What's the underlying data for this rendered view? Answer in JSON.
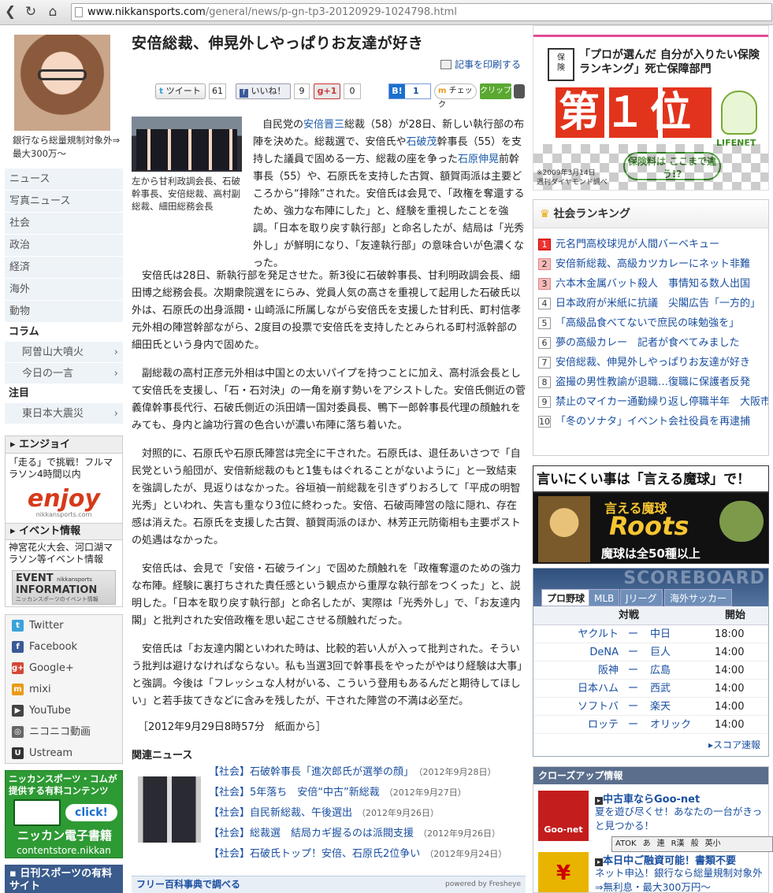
{
  "browser": {
    "url_host": "www.nikkansports.com",
    "url_path": "/general/news/p-gn-tp3-20120929-1024798.html"
  },
  "left": {
    "promo_text": "銀行なら総量規制対象外⇒最大300万〜",
    "nav": [
      "ニュース",
      "写真ニュース",
      "社会",
      "政治",
      "経済",
      "海外",
      "動物"
    ],
    "column_heading": "コラム",
    "column_items": [
      "阿曽山大噴火",
      "今日の一言"
    ],
    "attention_heading": "注目",
    "attention_items": [
      "東日本大震災"
    ],
    "enjoy_heading": "エンジョイ",
    "enjoy_text": "「走る」で挑戦！フルマラソン4時間以内",
    "enjoy_logo": "enjoy",
    "enjoy_site": "nikkansports.com",
    "event_heading": "イベント情報",
    "event_text": "神宮花火大会、河口湖マラソン等イベント情報",
    "event_logo_top": "EVENT",
    "event_logo_small": "nikkansports",
    "event_logo_bottom": "INFORMATION",
    "event_logo_caption": "ニッカンスポーツのイベント情報",
    "social": [
      {
        "label": "Twitter",
        "icon": "t",
        "color": "#3aa3d9"
      },
      {
        "label": "Facebook",
        "icon": "f",
        "color": "#3b5998"
      },
      {
        "label": "Google+",
        "icon": "g+",
        "color": "#d34836"
      },
      {
        "label": "mixi",
        "icon": "m",
        "color": "#e89b1a"
      },
      {
        "label": "YouTube",
        "icon": "▶",
        "color": "#444"
      },
      {
        "label": "ニコニコ動画",
        "icon": "◎",
        "color": "#666"
      },
      {
        "label": "Ustream",
        "icon": "U",
        "color": "#333"
      }
    ],
    "contents_heading": "ニッカンスポーツ・コムが提供する有料コンテンツ",
    "contents_click": "click!",
    "contents_title": "ニッカン電子書籍",
    "contents_site": "contentstore.nikkan",
    "paid_heading": "日刊スポーツの有料サイト"
  },
  "article": {
    "title": "安倍総裁、伸晃外しやっぱりお友達が好き",
    "print_label": "記事を印刷する",
    "tweet_label": "ツイート",
    "tweet_count": "61",
    "like_label": "いいね！",
    "like_count": "9",
    "gplus_label": "+1",
    "gplus_count": "0",
    "hatena_count": "1",
    "check_label": "チェック",
    "clip_label": "クリップ",
    "photo_caption": "左から甘利政調会長、石破幹事長、安倍総裁、高村副総裁、細田総務会長",
    "p1_pre": "自民党の",
    "p1_link1": "安倍晋三",
    "p1_mid1": "総裁（58）が28日、新しい執行部の布陣を決めた。総裁選で、安倍氏や",
    "p1_link2": "石破茂",
    "p1_mid2": "幹事長（55）を支持した議員で固める一方、総裁の座を争った",
    "p1_link3": "石原伸晃",
    "p1_rest": "前幹事長（55）や、石原氏を支持した古賀、額賀両派は主要どころから“排除”された。安倍氏は会見で、「政権を奪還するため、強力な布陣にした」と、経験を重視したことを強調。「日本を取り戻す執行部」と命名したが、結局は「光秀外し」が鮮明になり、「友達執行部」の意味合いが色濃くなった。",
    "p2": "安倍氏は28日、新執行部を発足させた。新3役に石破幹事長、甘利明政調会長、細田博之総務会長。次期衆院選をにらみ、党員人気の高さを重視して起用した石破氏以外は、石原氏の出身派閥・山崎派に所属しながら安倍氏を支援した甘利氏、町村信孝元外相の陣営幹部ながら、2度目の投票で安倍氏を支持したとみられる町村派幹部の細田氏という身内で固めた。",
    "p3": "副総裁の高村正彦元外相は中国との太いパイプを持つことに加え、高村派会長として安倍氏を支援し、「石・石対決」の一角を崩す勢いをアシストした。安倍氏側近の菅義偉幹事長代行、石破氏側近の浜田靖一国対委員長、鴨下一郎幹事長代理の顔触れをみても、身内と論功行賞の色合いが濃い布陣に落ち着いた。",
    "p4": "対照的に、石原氏や石原氏陣営は完全に干された。石原氏は、退任あいさつで「自民党という船団が、安倍新総裁のもと1隻もはぐれることがないように」と一致結束を強調したが、見返りはなかった。谷垣禎一前総裁を引きずりおろして「平成の明智光秀」といわれ、失言も重なり3位に終わった。安倍、石破両陣営の陰に隠れ、存在感は消えた。石原氏を支援した古賀、額賀両派のほか、林芳正元防衛相も主要ポストの処遇はなかった。",
    "p5": "安倍氏は、会見で「安倍・石破ライン」で固めた顔触れを「政権奪還のための強力な布陣。経験に裏打ちされた責任感という観点から重厚な執行部をつくった」と、説明した。「日本を取り戻す執行部」と命名したが、実際は「光秀外し」で、「お友達内閣」と批判された安倍政権を思い起こさせる顔触れだった。",
    "p6": "安倍氏は「お友達内閣といわれた時は、比較的若い人が入って批判された。そういう批判は避けなければならない。私も当選3回で幹事長をやったがやはり経験は大事」と強調。今後は「フレッシュな人材がいる、こういう登用もあるんだと期待してほしい」と若手抜てきなどに含みを残したが、干された陣営の不満は必至だ。",
    "dateline": "［2012年9月29日8時57分　紙面から］",
    "related_heading": "関連ニュース",
    "related": [
      {
        "title": "【社会】石破幹事長「進次郎氏が選挙の顔」",
        "date": "（2012年9月28日）"
      },
      {
        "title": "【社会】5年落ち　安倍“中古”新総裁",
        "date": "（2012年9月27日）"
      },
      {
        "title": "【社会】自民新総裁、午後選出",
        "date": "（2012年9月26日）"
      },
      {
        "title": "【社会】総裁選　結局カギ握るのは派閥支援",
        "date": "（2012年9月26日）"
      },
      {
        "title": "【社会】石破氏トップ！安倍、石原氏2位争い",
        "date": "（2012年9月24日）"
      }
    ],
    "wiki_label": "フリー百科事典で調べる",
    "wiki_powered": "powered by Fresheye"
  },
  "right": {
    "ad1_line1": "「プロが選んだ 自分が入りたい保険",
    "ad1_line2": "ランキング」死亡保障部門",
    "ad1_rank": "第１位",
    "ad1_brand": "LIFENET",
    "ad1_button": "保険料は ここまで違う!?",
    "ad1_note1": "※2009年3月14日",
    "ad1_note2": "週刊ダイヤモンド調べ",
    "ranking_heading": "社会ランキング",
    "ranking": [
      "元名門高校球児が人間バーベキュー",
      "安倍新総裁、高級カツカレーにネット非難",
      "六本木金属バット殺人　事情知る数人出国",
      "日本政府が米紙に抗議　尖閣広告「一方的」",
      "「高級品食べてないで庶民の味勉強を」",
      "夢の高級カレー　記者が食べてみました",
      "安倍総裁、伸晃外しやっぱりお友達が好き",
      "盗撮の男性教諭が退職…復職に保護者反発",
      "禁止のマイカー通勤繰り返し停職半年　大阪市",
      "「冬のソナタ」イベント会社役員を再逮捕"
    ],
    "ad2_top": "言いにくい事は「言える魔球」で！",
    "ad2_title": "言える魔球",
    "ad2_brand": "Roots",
    "ad2_bottom": "魔球は全50種以上",
    "scoreboard_title": "SCOREBOARD",
    "score_tabs": [
      "プロ野球",
      "MLB",
      "Jリーグ",
      "海外サッカー"
    ],
    "score_head_match": "対戦",
    "score_head_time": "開始",
    "games": [
      {
        "home": "ヤクルト",
        "vs": "ー",
        "away": "中日",
        "time": "18:00"
      },
      {
        "home": "DeNA",
        "vs": "ー",
        "away": "巨人",
        "time": "14:00"
      },
      {
        "home": "阪神",
        "vs": "ー",
        "away": "広島",
        "time": "14:00"
      },
      {
        "home": "日本ハム",
        "vs": "ー",
        "away": "西武",
        "time": "14:00"
      },
      {
        "home": "ソフトバ",
        "vs": "ー",
        "away": "楽天",
        "time": "14:00"
      },
      {
        "home": "ロッテ",
        "vs": "ー",
        "away": "オリック",
        "time": "14:00"
      }
    ],
    "score_link": "スコア速報",
    "closeup_heading": "クローズアップ情報",
    "closeup": [
      {
        "title": "中古車ならGoo-net",
        "text": "夏を遊び尽くせ！あなたの一台がきっと見つかる！",
        "logo": "Goo-net"
      },
      {
        "title": "本日中ご融資可能！書類不要",
        "text": "ネット申込！銀行なら総量規制対象外⇒無利息・最大300万円〜",
        "logo": "¥"
      }
    ],
    "ime_items": [
      "ATOK",
      "あ",
      "連",
      "R漢",
      "般",
      "英小"
    ]
  }
}
